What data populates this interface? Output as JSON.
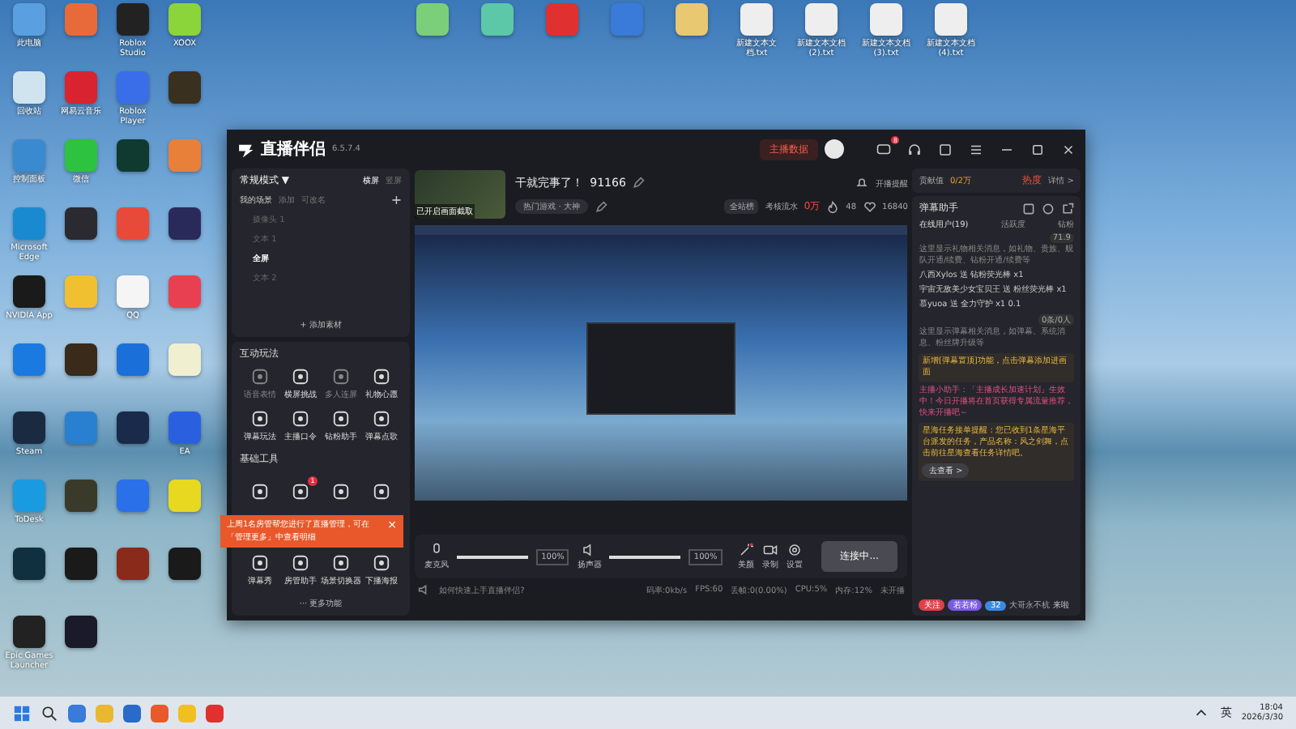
{
  "desktop": {
    "left_icons": [
      {
        "label": "此电脑",
        "color": "#5aa0e0"
      },
      {
        "color": "#e86a3a"
      },
      {
        "label": "Roblox Studio",
        "color": "#222222"
      },
      {
        "label": "XOOX",
        "color": "#8bd43a"
      },
      {
        "label": "回收站",
        "color": "#d0e4f0"
      },
      {
        "label": "网易云音乐",
        "color": "#d9232e"
      },
      {
        "label": "Roblox Player",
        "color": "#3a6ee8"
      },
      {
        "color": "#3a3020"
      },
      {
        "label": "控制面板",
        "color": "#3a8ad0"
      },
      {
        "label": "微信",
        "color": "#2dc23f"
      },
      {
        "color": "#103a30"
      },
      {
        "color": "#e8803a"
      },
      {
        "label": "Microsoft Edge",
        "color": "#1a8ad0"
      },
      {
        "color": "#2a2a30"
      },
      {
        "color": "#e84a3a"
      },
      {
        "color": "#2a2a5a"
      },
      {
        "label": "NVIDIA App",
        "color": "#1a1a1a"
      },
      {
        "color": "#f0c030"
      },
      {
        "label": "QQ",
        "color": "#f5f5f5"
      },
      {
        "color": "#e84050"
      },
      {
        "color": "#1a7ae0"
      },
      {
        "color": "#3a2a1a"
      },
      {
        "color": "#1a70d8"
      },
      {
        "color": "#f0f0d0"
      },
      {
        "label": "Steam",
        "color": "#1a2a40"
      },
      {
        "color": "#2a80d0"
      },
      {
        "color": "#1a2a4a"
      },
      {
        "label": "EA",
        "color": "#2a60e0"
      },
      {
        "label": "ToDesk",
        "color": "#1a9ae0"
      },
      {
        "color": "#3a3a2a"
      },
      {
        "color": "#2a70e8"
      },
      {
        "color": "#e8d820"
      },
      {
        "color": "#103040"
      },
      {
        "color": "#1a1a1a"
      },
      {
        "color": "#8a2a1a"
      },
      {
        "color": "#1a1a1a"
      },
      {
        "label": "Epic Games Launcher",
        "color": "#222222"
      },
      {
        "color": "#1a1a2a"
      }
    ],
    "top_icons": [
      {
        "color": "#7ccf7a"
      },
      {
        "color": "#5cc8a8"
      },
      {
        "color": "#e03030"
      },
      {
        "color": "#3a7ad8"
      },
      {
        "color": "#e8c870"
      },
      {
        "label": "新建文本文档.txt",
        "color": "#eeeeee"
      },
      {
        "label": "新建文本文档 (2).txt",
        "color": "#eeeeee"
      },
      {
        "label": "新建文本文档 (3).txt",
        "color": "#eeeeee"
      },
      {
        "label": "新建文本文档 (4).txt",
        "color": "#eeeeee"
      }
    ]
  },
  "window": {
    "app_name": "直播伴侣",
    "version": "6.5.7.4",
    "data_button": "主播数据",
    "message_badge": "8"
  },
  "left_panel": {
    "mode": "常规模式",
    "mode_caret": "▼",
    "orientations": [
      {
        "label": "横屏",
        "selected": true
      },
      {
        "label": "竖屏",
        "selected": false
      }
    ],
    "scene_tabs": [
      {
        "label": "我的场景",
        "selected": true
      },
      {
        "label": "添加",
        "selected": false
      },
      {
        "label": "可改名",
        "selected": false
      }
    ],
    "add_scene": "+",
    "sources": [
      {
        "name": "摄像头 1",
        "selected": false
      },
      {
        "name": "文本 1",
        "selected": false
      },
      {
        "name": "全屏",
        "selected": true
      },
      {
        "name": "文本 2",
        "selected": false
      }
    ],
    "add_source": "+ 添加素材",
    "interactive": {
      "title": "互动玩法",
      "tools": [
        {
          "label": "语音表情",
          "disabled": true
        },
        {
          "label": "横屏挑战",
          "disabled": false
        },
        {
          "label": "多人连屏",
          "disabled": true
        },
        {
          "label": "礼物心愿",
          "disabled": false
        },
        {
          "label": "弹幕玩法",
          "disabled": false
        },
        {
          "label": "主播口令",
          "disabled": false
        },
        {
          "label": "钻粉助手",
          "disabled": false
        },
        {
          "label": "弹幕点歌",
          "disabled": false
        }
      ]
    },
    "basic": {
      "title": "基础工具",
      "tools": [
        {
          "disabled": false
        },
        {
          "badge": "1",
          "disabled": false
        },
        {
          "disabled": false
        },
        {
          "disabled": false
        },
        {
          "label": "弹幕秀",
          "disabled": false
        },
        {
          "label": "房管助手",
          "disabled": false
        },
        {
          "label": "场景切换器",
          "disabled": false
        },
        {
          "label": "下播海报",
          "disabled": false
        }
      ]
    },
    "more": "··· 更多功能"
  },
  "toast": {
    "text": "上周1名房管帮您进行了直播管理，可在「管理更多」中查看明细",
    "close": "×"
  },
  "stream": {
    "thumb_text": "已开启画面截取",
    "title": "干就完事了！",
    "room": "91166",
    "category": "热门游戏 · 大神",
    "reminder": "开播提醒",
    "rank": "全站榜",
    "revenue_label": "考核流水",
    "revenue": "0万",
    "hot": "48",
    "likes": "16840"
  },
  "controls": {
    "mic": {
      "label": "麦克风",
      "level": 1,
      "reading": "100%"
    },
    "speaker": {
      "label": "扬声器",
      "level": 1,
      "reading": "100%"
    },
    "beauty": "美颜",
    "record": "录制",
    "settings": "设置",
    "connect": "连接中..."
  },
  "status": {
    "help": "如何快速上手直播伴侣?",
    "stats": [
      "码率:0kb/s",
      "FPS:60",
      "丢帧:0(0.00%)",
      "CPU:5%",
      "内存:12%",
      "未开播"
    ]
  },
  "right_panel": {
    "contribution": "贡献值",
    "contribution_value": "0/2万",
    "heat": "热度",
    "details": "详情 >",
    "title": "弹幕助手",
    "tabs": [
      {
        "label": "在线用户(19)",
        "selected": true
      },
      {
        "label": "活跃度",
        "selected": false
      },
      {
        "label": "钻粉",
        "selected": false
      }
    ],
    "messages": [
      {
        "kind": "hint",
        "text": "这里显示礼物相关消息，如礼物、贵族、舰队开通/续费、钻粉开通/续费等",
        "badge": "71.9"
      },
      {
        "kind": "gift",
        "text": "八西Xylos 送 钻粉荧光棒 x1"
      },
      {
        "kind": "gift",
        "text": "宇宙无敌美少女宝贝王 送 粉丝荧光棒 x1"
      },
      {
        "kind": "gift",
        "text": "慕yuoa 送 全力守护 x1 0.1"
      },
      {
        "kind": "hint",
        "text": "这里显示弹幕相关消息，如弹幕、系统消息、粉丝牌升级等",
        "badge": "0条/0人"
      },
      {
        "kind": "notice",
        "text": "新增[弹幕置顶]功能，点击弹幕添加进画面"
      },
      {
        "kind": "assistant",
        "text": "主播小助手：「主播成长加速计划」生效中！今日开播将在首页获得专属流量推荐，快来开播吧～"
      },
      {
        "kind": "task",
        "text": "星海任务接单提醒：您已收到1条星海平台派发的任务，产品名称：风之剑舞，点击前往星海查看任务详情吧。",
        "button": "去查看 >"
      }
    ],
    "entry": {
      "tags": [
        {
          "text": "关注",
          "color": "#e0404a"
        },
        {
          "text": "若若粉",
          "color": "#7a5ae0"
        },
        {
          "text": "32",
          "color": "#3a8ae0"
        }
      ],
      "name": "大哥永不杭",
      "action": "来啦"
    }
  },
  "taskbar": {
    "icons": [
      {
        "color": "#3a7ad8"
      },
      {
        "color": "#e8b830"
      },
      {
        "color": "#2a6ac8"
      },
      {
        "color": "#e85a2a"
      },
      {
        "color": "#f0c020"
      },
      {
        "color": "#e03030"
      }
    ],
    "lang": "英",
    "time": "18:04",
    "date": "2026/3/30"
  }
}
